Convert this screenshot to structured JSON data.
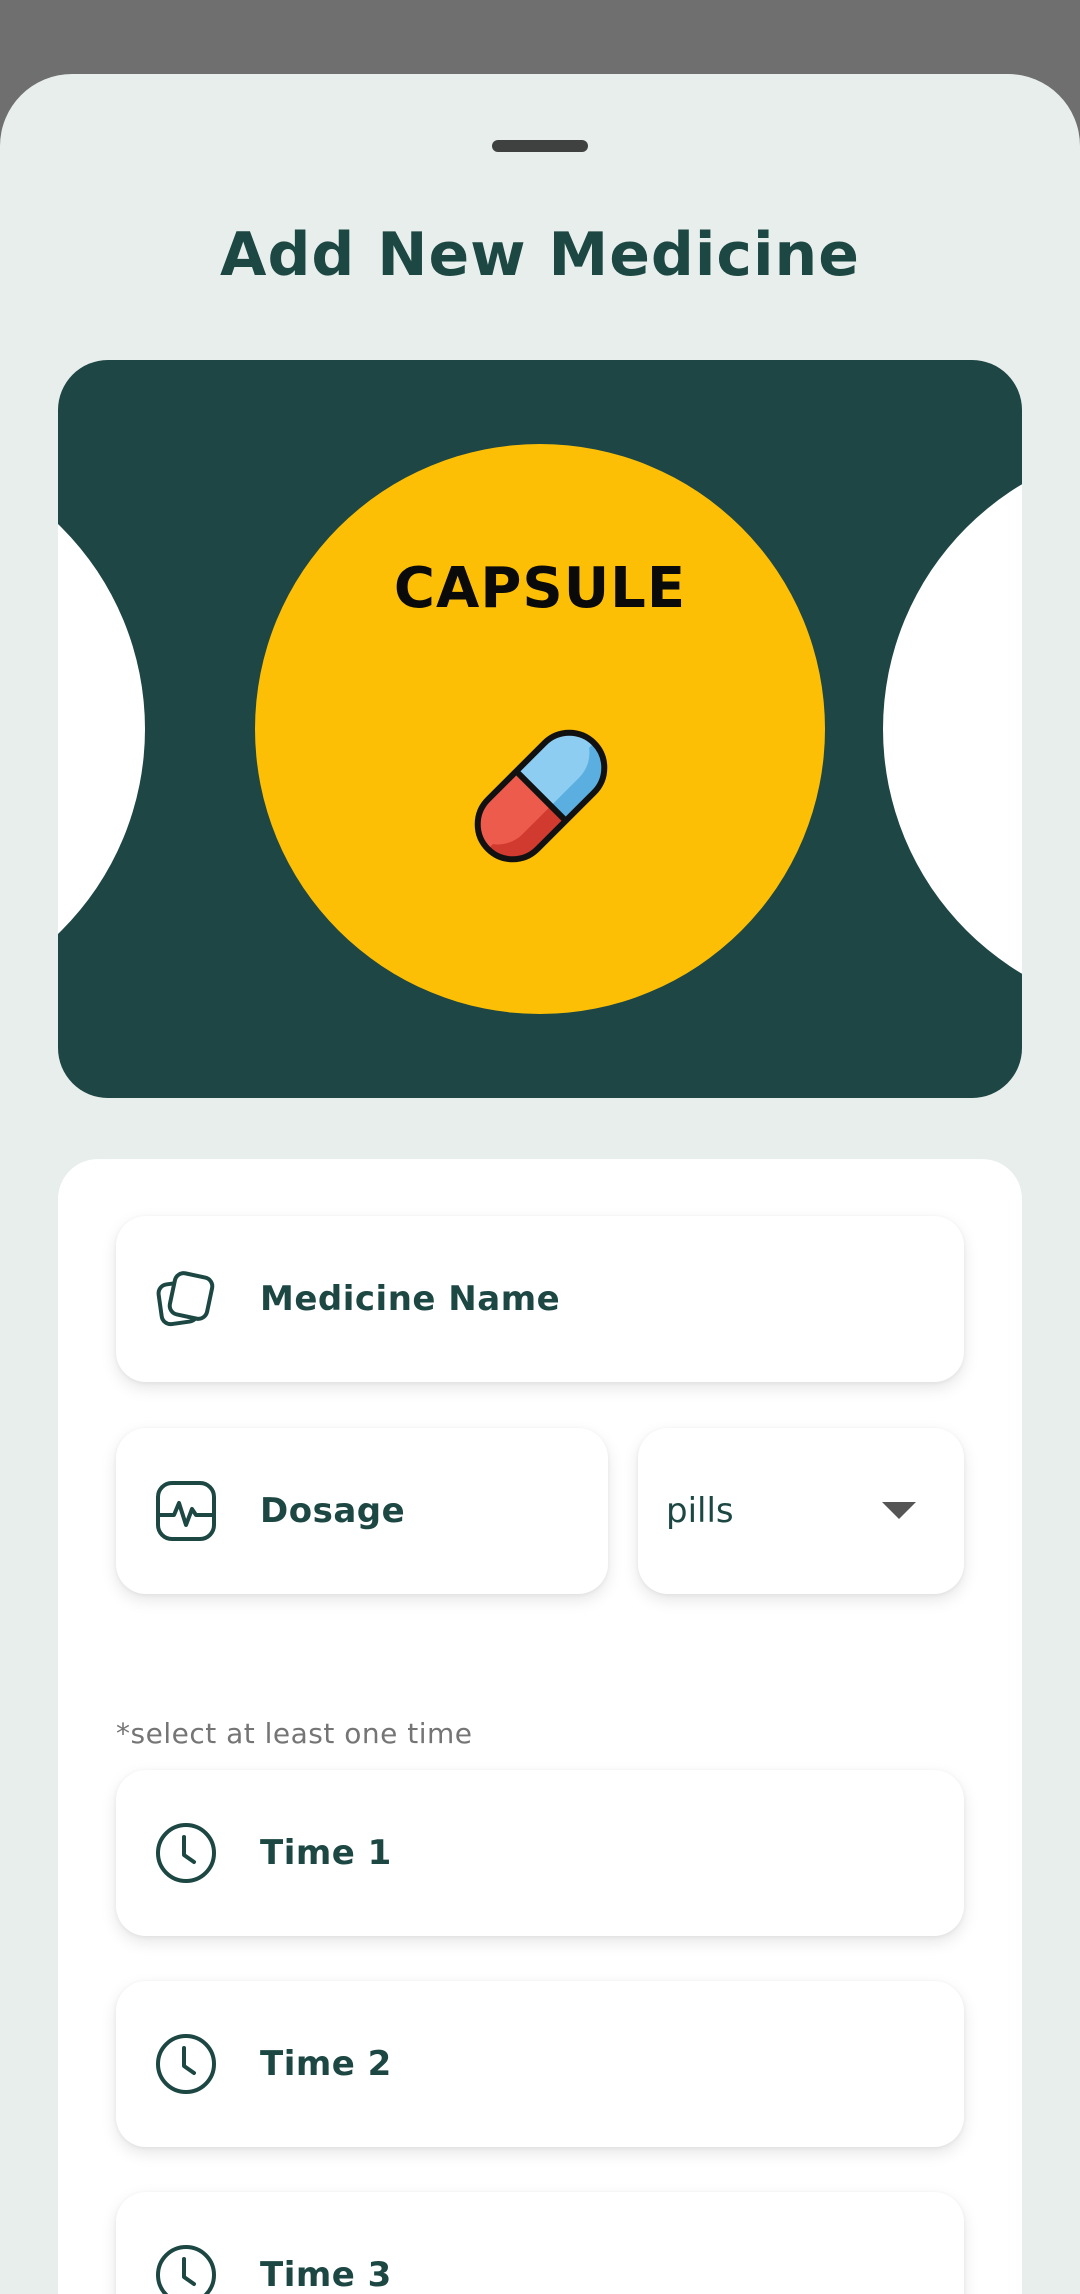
{
  "sheet": {
    "title": "Add New Medicine"
  },
  "carousel": {
    "selected_label": "CAPSULE",
    "selected_icon": "capsule-icon"
  },
  "form": {
    "medicine_name_label": "Medicine Name",
    "dosage_label": "Dosage",
    "unit_value": "pills",
    "time_hint": "*select at least one time",
    "times": [
      "Time 1",
      "Time 2",
      "Time 3"
    ]
  },
  "colors": {
    "primary": "#1c4743",
    "accent": "#fdbf05",
    "sheet_bg": "#e8eeec"
  }
}
